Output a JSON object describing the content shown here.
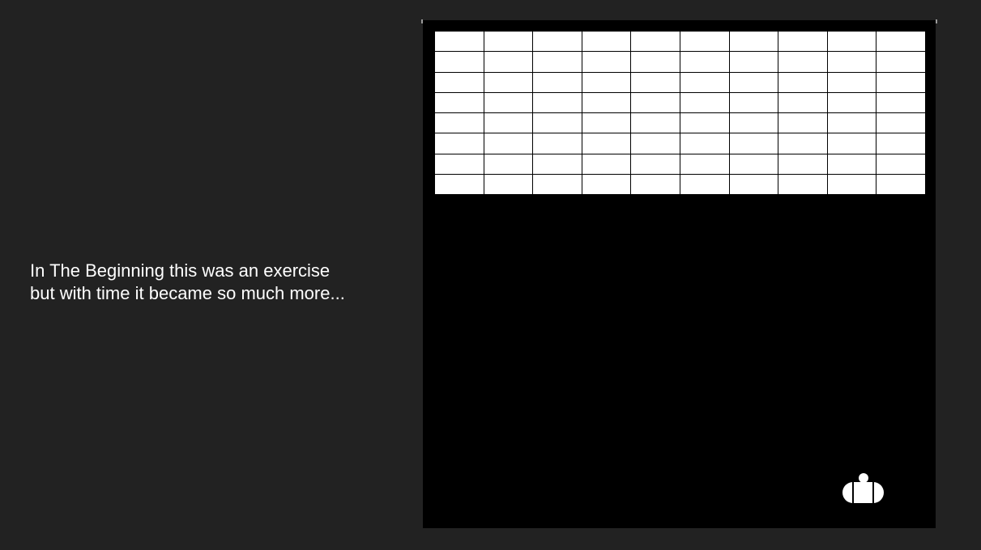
{
  "intro": {
    "line1": "In The Beginning this was an exercise",
    "line2": "but with time it became so much more..."
  },
  "game": {
    "brick_rows": 8,
    "brick_cols": 10,
    "colors": {
      "page_background": "#222222",
      "board_background": "#000000",
      "brick": "#ffffff",
      "paddle": "#ffffff",
      "ball": "#ffffff",
      "text": "#ffffff"
    }
  }
}
